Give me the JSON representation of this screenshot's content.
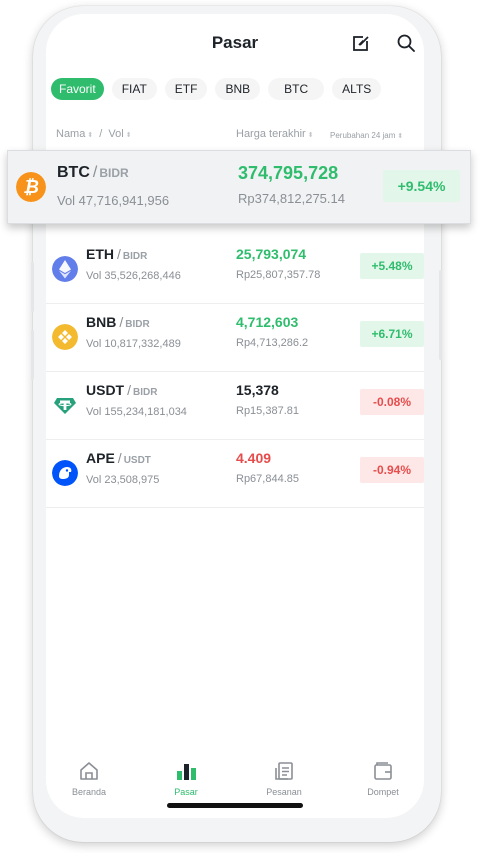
{
  "header": {
    "title": "Pasar"
  },
  "tabs": [
    "Favorit",
    "FIAT",
    "ETF",
    "BNB",
    "BTC",
    "ALTS"
  ],
  "columns": {
    "name": "Nama",
    "vol": "Vol",
    "last_price": "Harga terakhir",
    "change": "Perubahan 24 jam"
  },
  "rows": [
    {
      "base": "BTC",
      "quote": "BIDR",
      "vol": "Vol 47,716,941,956",
      "price": "374,795,728",
      "fiat": "Rp374,812,275.14",
      "change": "+9.54%",
      "direction": "up",
      "icon": "bitcoin-icon"
    },
    {
      "base": "ETH",
      "quote": "BIDR",
      "vol": "Vol 35,526,268,446",
      "price": "25,793,074",
      "fiat": "Rp25,807,357.78",
      "change": "+5.48%",
      "direction": "up",
      "icon": "ethereum-icon"
    },
    {
      "base": "BNB",
      "quote": "BIDR",
      "vol": "Vol 10,817,332,489",
      "price": "4,712,603",
      "fiat": "Rp4,713,286.2",
      "change": "+6.71%",
      "direction": "up",
      "icon": "bnb-icon"
    },
    {
      "base": "USDT",
      "quote": "BIDR",
      "vol": "Vol 155,234,181,034",
      "price": "15,378",
      "fiat": "Rp15,387.81",
      "change": "-0.08%",
      "direction": "down",
      "icon": "tether-icon"
    },
    {
      "base": "APE",
      "quote": "USDT",
      "vol": "Vol 23,508,975",
      "price": "4.409",
      "fiat": "Rp67,844.85",
      "change": "-0.94%",
      "direction": "down",
      "icon": "apecoin-icon"
    }
  ],
  "nav": [
    {
      "label": "Beranda",
      "icon": "home-icon"
    },
    {
      "label": "Pasar",
      "icon": "markets-icon",
      "active": true
    },
    {
      "label": "Pesanan",
      "icon": "orders-icon"
    },
    {
      "label": "Dompet",
      "icon": "wallet-icon"
    }
  ],
  "colors": {
    "up": "#2fbd6d",
    "down": "#e74c4c",
    "accent": "#2fbd6d",
    "bitcoin": "#f7931a",
    "bnb": "#f3ba2f",
    "tether": "#26a17b",
    "ethereum": "#627eea",
    "apecoin": "#0054f9"
  }
}
